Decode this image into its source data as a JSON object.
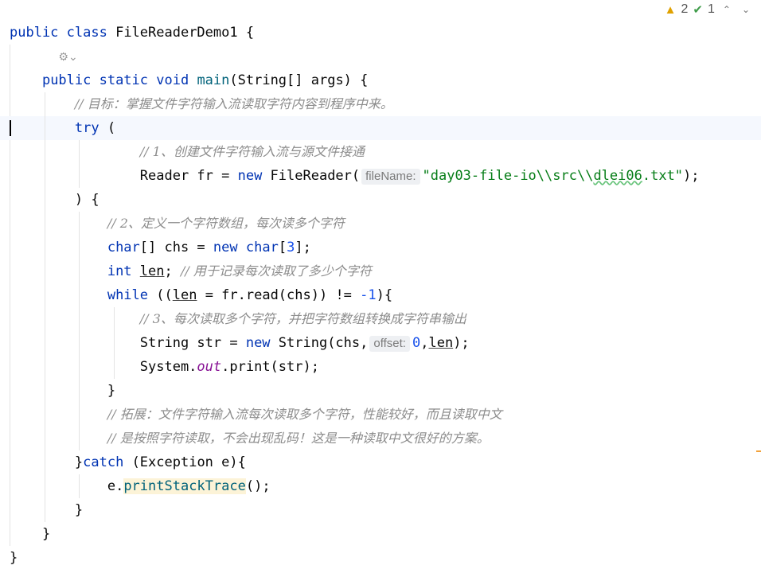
{
  "status": {
    "warnings": "2",
    "checks": "1",
    "warn_icon": "▲",
    "check_icon": "✔",
    "nav_up": "⌃",
    "nav_down": "⌄"
  },
  "code": {
    "l1_kw": "public class",
    "l1_cls": "FileReaderDemo1",
    "l1_brace": "{",
    "gear": "⚙⌄",
    "l3_kw": "public static void",
    "l3_fn": "main",
    "l3_rest": "(String[] args) {",
    "c1": "// 目标：掌握文件字符输入流读取字符内容到程序中来。",
    "try_kw": "try",
    "try_paren": "(",
    "c2": "// 1、创建文件字符输入流与源文件接通",
    "l7_a": "Reader fr = ",
    "l7_new": "new",
    "l7_b": " FileReader(",
    "hint_filename": "fileName:",
    "l7_str1": "\"day03-file-io\\\\src\\\\",
    "l7_str2": "dlei06",
    "l7_str3": ".txt\"",
    "l7_end": ");",
    "l8": ") {",
    "c3": "// 2、定义一个字符数组，每次读多个字符",
    "l10_a": "char",
    "l10_b": "[] chs = ",
    "l10_new": "new",
    "l10_c": "char",
    "l10_d": "[",
    "l10_num": "3",
    "l10_e": "];",
    "l11_kw": "int",
    "l11_var": "len",
    "l11_semi": "; ",
    "c4": "// 用于记录每次读取了多少个字符",
    "l12_kw": "while",
    "l12_a": " ((",
    "l12_var": "len",
    "l12_b": " = fr.read(chs)) != ",
    "l12_num": "-1",
    "l12_c": "){",
    "c5": "// 3、每次读取多个字符，并把字符数组转换成字符串输出",
    "l14_a": "String str = ",
    "l14_new": "new",
    "l14_b": " String(chs,",
    "hint_offset": "offset:",
    "l14_num": "0",
    "l14_comma": ",",
    "l14_var": "len",
    "l14_end": ");",
    "l15_a": "System.",
    "l15_fld": "out",
    "l15_b": ".print(str);",
    "l16": "}",
    "c6": "// 拓展：文件字符输入流每次读取多个字符，性能较好，而且读取中文",
    "c7": "// 是按照字符读取，不会出现乱码！这是一种读取中文很好的方案。",
    "l19_a": "}",
    "l19_kw": "catch",
    "l19_b": " (Exception e){",
    "l20_a": "e.",
    "l20_fn": "printStackTrace",
    "l20_b": "();",
    "l21": "}",
    "l22": "}",
    "l23": "}"
  }
}
